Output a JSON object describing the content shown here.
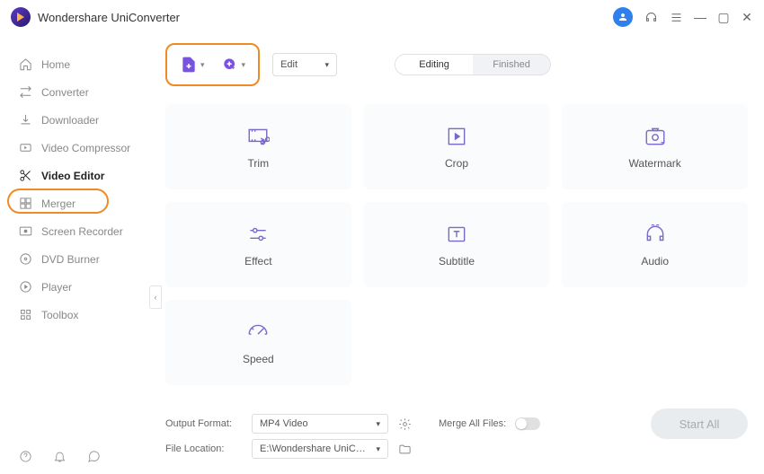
{
  "app_title": "Wondershare UniConverter",
  "sidebar": {
    "items": [
      {
        "label": "Home"
      },
      {
        "label": "Converter"
      },
      {
        "label": "Downloader"
      },
      {
        "label": "Video Compressor"
      },
      {
        "label": "Video Editor"
      },
      {
        "label": "Merger"
      },
      {
        "label": "Screen Recorder"
      },
      {
        "label": "DVD Burner"
      },
      {
        "label": "Player"
      },
      {
        "label": "Toolbox"
      }
    ]
  },
  "toolbar": {
    "edit_label": "Edit",
    "seg_editing": "Editing",
    "seg_finished": "Finished"
  },
  "cards": {
    "trim": "Trim",
    "crop": "Crop",
    "watermark": "Watermark",
    "effect": "Effect",
    "subtitle": "Subtitle",
    "audio": "Audio",
    "speed": "Speed"
  },
  "bottom": {
    "output_format_label": "Output Format:",
    "output_format_value": "MP4 Video",
    "file_location_label": "File Location:",
    "file_location_value": "E:\\Wondershare UniConverter",
    "merge_label": "Merge All Files:",
    "start_label": "Start All"
  }
}
